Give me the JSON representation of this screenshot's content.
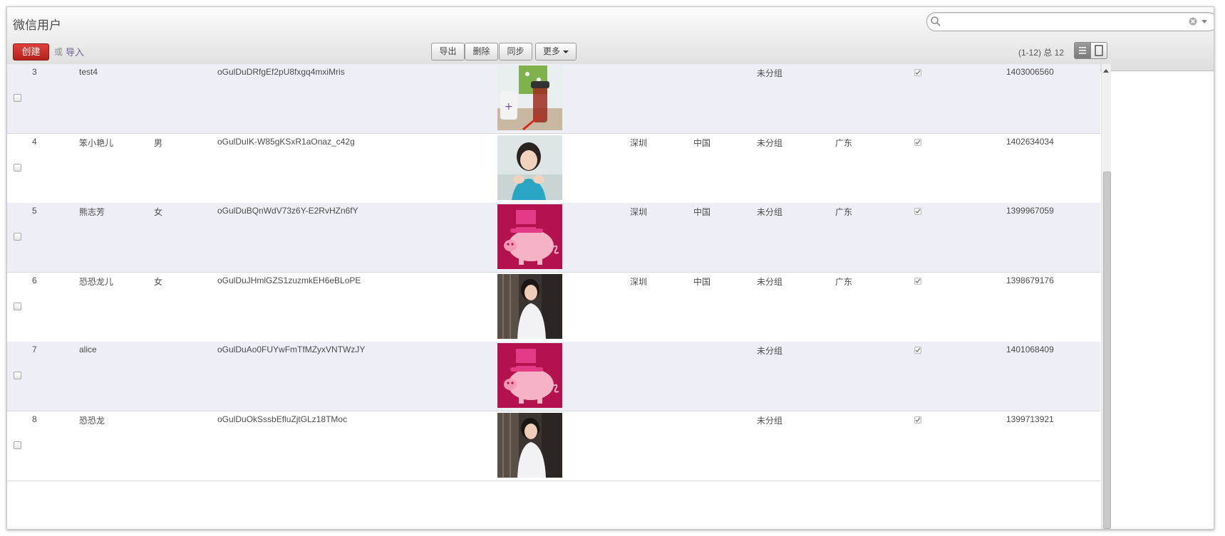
{
  "header": {
    "title": "微信用户",
    "search": {
      "placeholder": "",
      "value": ""
    },
    "create_label": "创建",
    "or_text": "或",
    "import_label": "导入",
    "toolbar": {
      "export_label": "导出",
      "delete_label": "删除",
      "sync_label": "同步",
      "more_label": "更多"
    },
    "pager": "(1-12) 总 12"
  },
  "rows": [
    {
      "id": "3",
      "name": "test4",
      "gender": "",
      "openid": "oGulDuDRfgEf2pU8fxgq4mxiMris",
      "city": "",
      "country": "",
      "group": "未分组",
      "province": "",
      "subscribed": true,
      "timestamp": "1403006560",
      "avatar": "desk-photo"
    },
    {
      "id": "4",
      "name": "笨小艳儿",
      "gender": "男",
      "openid": "oGulDuIK-W85gKSxR1aOnaz_c42g",
      "city": "深圳",
      "country": "中国",
      "group": "未分组",
      "province": "广东",
      "subscribed": true,
      "timestamp": "1402634034",
      "avatar": "woman-photo"
    },
    {
      "id": "5",
      "name": "熊志芳",
      "gender": "女",
      "openid": "oGulDuBQnWdV73z6Y-E2RvHZn6fY",
      "city": "深圳",
      "country": "中国",
      "group": "未分组",
      "province": "广东",
      "subscribed": true,
      "timestamp": "1399967059",
      "avatar": "pig-hat-icon"
    },
    {
      "id": "6",
      "name": "恐恐龙儿",
      "gender": "女",
      "openid": "oGulDuJHmlGZS1zuzmkEH6eBLoPE",
      "city": "深圳",
      "country": "中国",
      "group": "未分组",
      "province": "广东",
      "subscribed": true,
      "timestamp": "1398679176",
      "avatar": "woman-door-photo"
    },
    {
      "id": "7",
      "name": "alice",
      "gender": "",
      "openid": "oGulDuAo0FUYwFmTfMZyxVNTWzJY",
      "city": "",
      "country": "",
      "group": "未分组",
      "province": "",
      "subscribed": true,
      "timestamp": "1401068409",
      "avatar": "pig-hat-icon"
    },
    {
      "id": "8",
      "name": "恐恐龙",
      "gender": "",
      "openid": "oGulDuOkSssbEfluZjtGLz18TMoc",
      "city": "",
      "country": "",
      "group": "未分组",
      "province": "",
      "subscribed": true,
      "timestamp": "1399713921",
      "avatar": "woman-door-photo"
    }
  ],
  "colors": {
    "create_button": "#c7302a",
    "row_alt": "#eeeef6",
    "link": "#6d5f8f"
  }
}
